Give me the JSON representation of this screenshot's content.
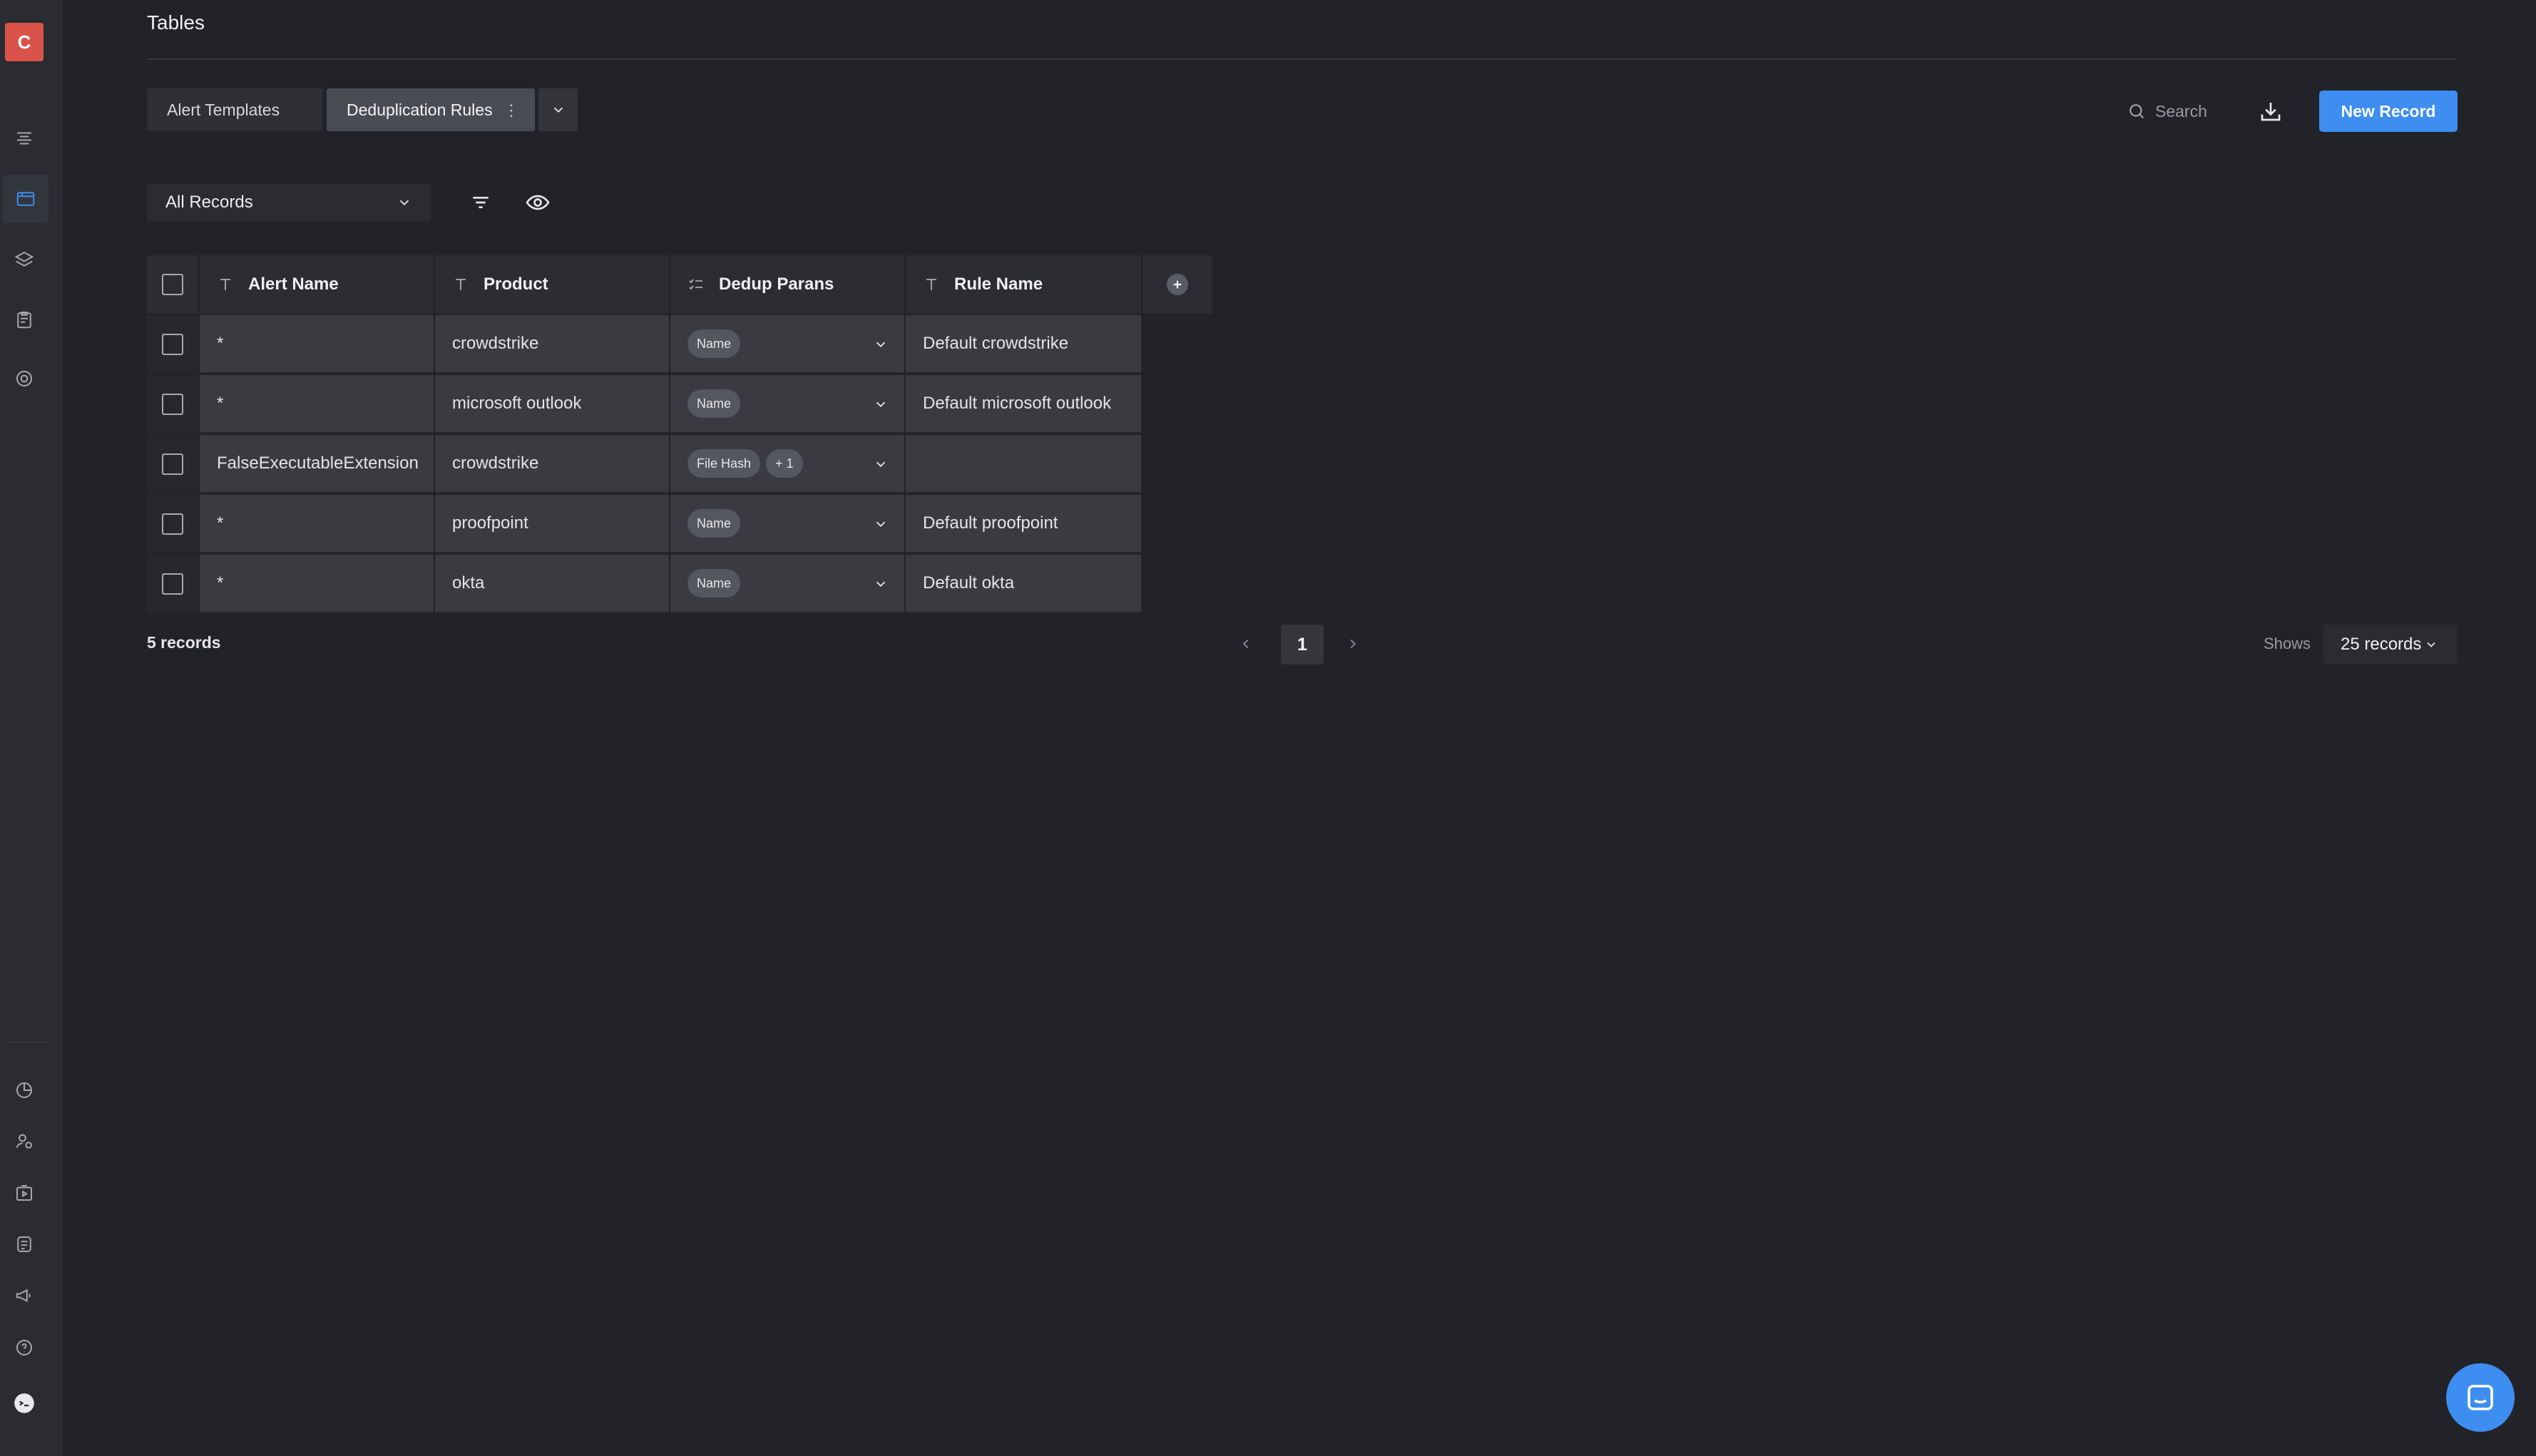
{
  "sidebar": {
    "avatar_initial": "C"
  },
  "header": {
    "title": "Tables"
  },
  "tabs": [
    {
      "label": "Alert Templates"
    },
    {
      "label": "Deduplication Rules",
      "active": true
    }
  ],
  "toolbar": {
    "search_label": "Search",
    "new_record_label": "New Record",
    "view_label": "All Records"
  },
  "table": {
    "columns": [
      "Alert Name",
      "Product",
      "Dedup Parans",
      "Rule Name"
    ],
    "rows": [
      {
        "alert_name": "*",
        "product": "crowdstrike",
        "dedup": [
          "Name"
        ],
        "rule_name": "Default crowdstrike"
      },
      {
        "alert_name": "*",
        "product": "microsoft outlook",
        "dedup": [
          "Name"
        ],
        "rule_name": "Default microsoft outlook"
      },
      {
        "alert_name": "FalseExecutableExtension",
        "product": "crowdstrike",
        "dedup": [
          "File Hash",
          "+ 1"
        ],
        "rule_name": ""
      },
      {
        "alert_name": "*",
        "product": "proofpoint",
        "dedup": [
          "Name"
        ],
        "rule_name": "Default proofpoint"
      },
      {
        "alert_name": "*",
        "product": "okta",
        "dedup": [
          "Name"
        ],
        "rule_name": "Default okta"
      }
    ]
  },
  "footer": {
    "record_count": "5 records",
    "current_page": "1",
    "shows_label": "Shows",
    "per_page": "25 records"
  },
  "colors": {
    "accent": "#3d8ef0",
    "avatar": "#d9534a",
    "background": "#222329"
  }
}
